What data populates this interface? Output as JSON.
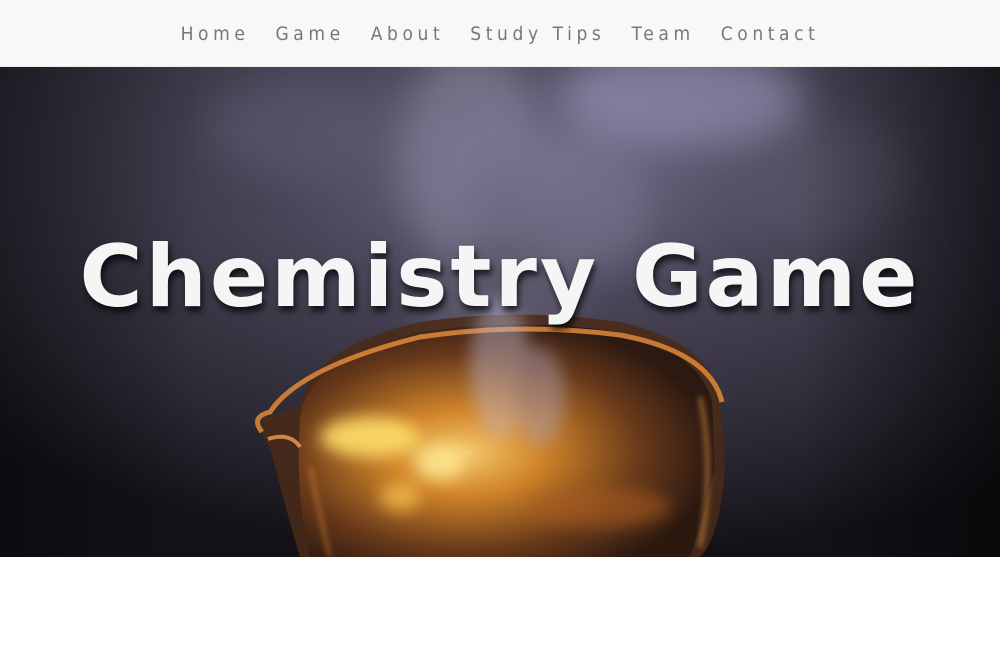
{
  "nav": {
    "items": [
      {
        "label": "Home"
      },
      {
        "label": "Game"
      },
      {
        "label": "About"
      },
      {
        "label": "Study Tips"
      },
      {
        "label": "Team"
      },
      {
        "label": "Contact"
      }
    ]
  },
  "hero": {
    "title": "Chemistry Game",
    "image": "smoking-beaker-photo"
  }
}
